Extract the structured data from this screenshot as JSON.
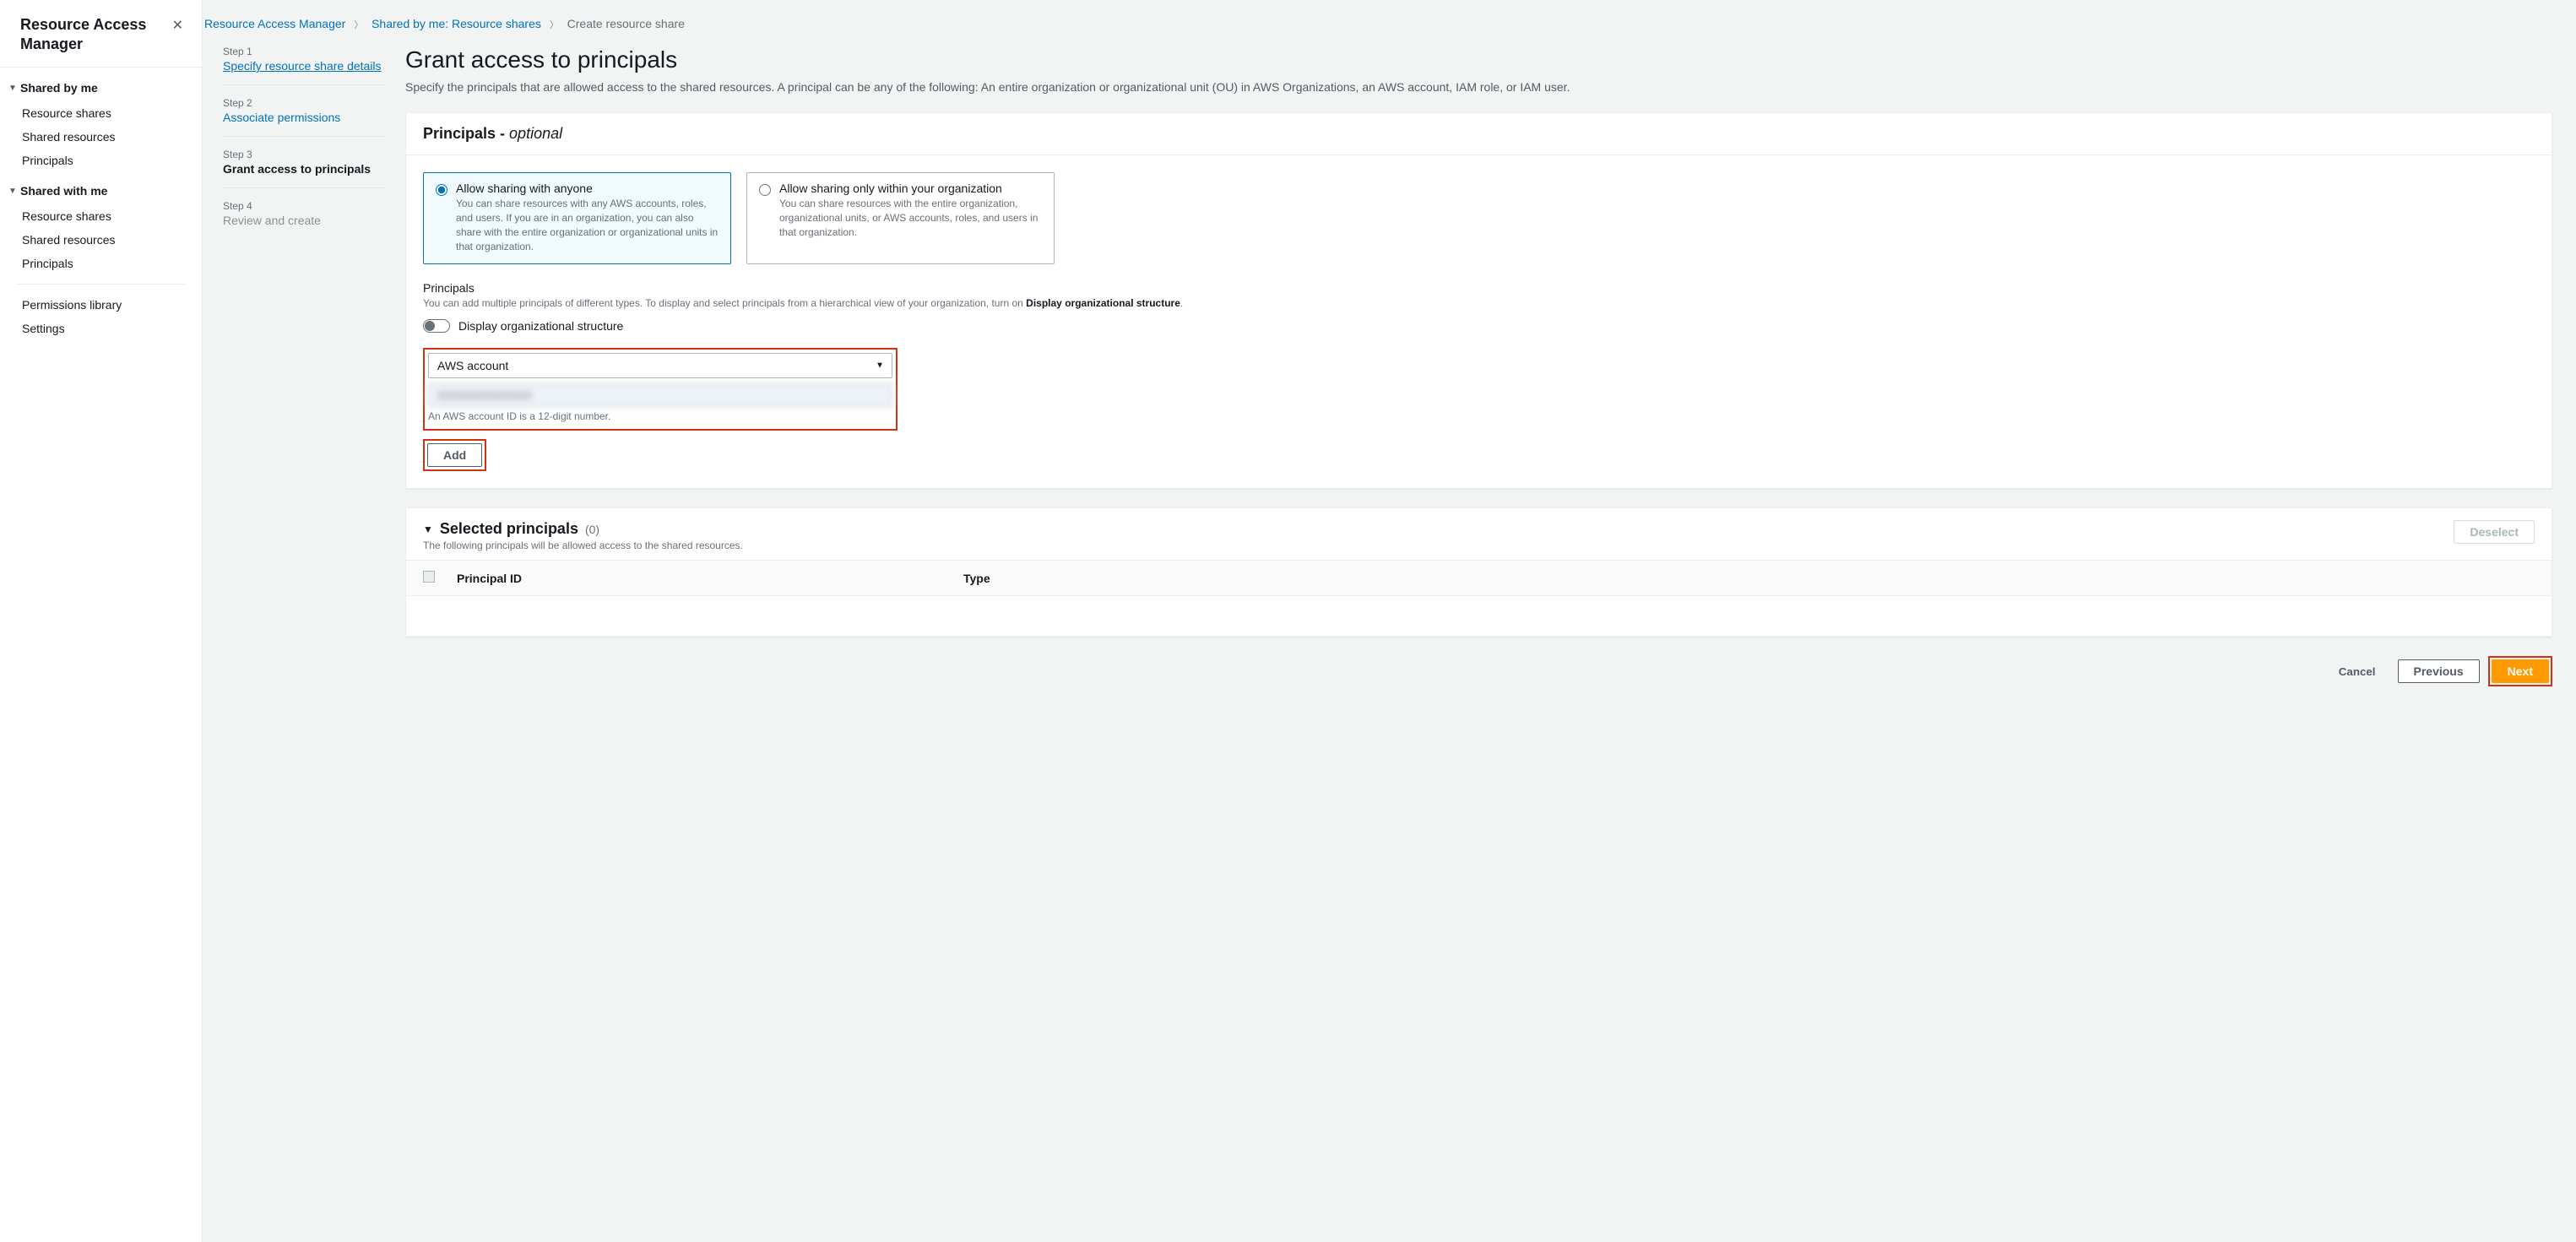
{
  "sidebar": {
    "title": "Resource Access Manager",
    "groups": [
      {
        "label": "Shared by me",
        "items": [
          "Resource shares",
          "Shared resources",
          "Principals"
        ]
      },
      {
        "label": "Shared with me",
        "items": [
          "Resource shares",
          "Shared resources",
          "Principals"
        ]
      }
    ],
    "footer_items": [
      "Permissions library",
      "Settings"
    ]
  },
  "breadcrumb": {
    "items": [
      "Resource Access Manager",
      "Shared by me: Resource shares",
      "Create resource share"
    ]
  },
  "steps": [
    {
      "num": "Step 1",
      "label": "Specify resource share details",
      "state": "done"
    },
    {
      "num": "Step 2",
      "label": "Associate permissions",
      "state": "done-plain"
    },
    {
      "num": "Step 3",
      "label": "Grant access to principals",
      "state": "current"
    },
    {
      "num": "Step 4",
      "label": "Review and create",
      "state": "future"
    }
  ],
  "page": {
    "title": "Grant access to principals",
    "description": "Specify the principals that are allowed access to the shared resources. A principal can be any of the following: An entire organization or organizational unit (OU) in AWS Organizations, an AWS account, IAM role, or IAM user."
  },
  "principals_panel": {
    "heading": "Principals - ",
    "heading_opt": "optional",
    "radio_anyone": {
      "title": "Allow sharing with anyone",
      "desc": "You can share resources with any AWS accounts, roles, and users. If you are in an organization, you can also share with the entire organization or organizational units in that organization."
    },
    "radio_org": {
      "title": "Allow sharing only within your organization",
      "desc": "You can share resources with the entire organization, organizational units, or AWS accounts, roles, and users in that organization."
    },
    "principals_label": "Principals",
    "principals_help_a": "You can add multiple principals of different types. To display and select principals from a hierarchical view of your organization, turn on ",
    "principals_help_b": "Display organizational structure",
    "toggle_label": "Display organizational structure",
    "select_value": "AWS account",
    "input_value": "XXXXXXXXXXXX",
    "input_help": "An AWS account ID is a 12-digit number.",
    "add_label": "Add"
  },
  "selected_panel": {
    "title": "Selected principals",
    "count": "(0)",
    "subtitle": "The following principals will be allowed access to the shared resources.",
    "deselect_label": "Deselect",
    "col_id": "Principal ID",
    "col_type": "Type"
  },
  "footer": {
    "cancel": "Cancel",
    "previous": "Previous",
    "next": "Next"
  }
}
